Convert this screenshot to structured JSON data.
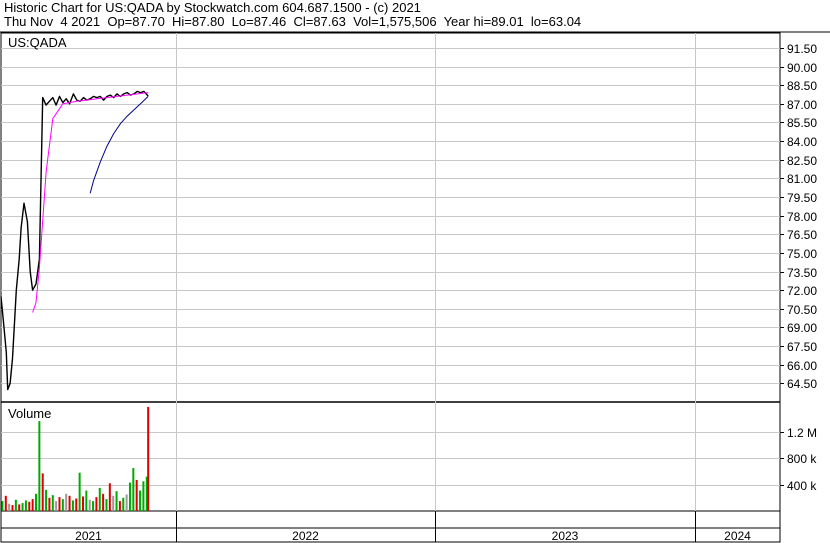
{
  "header": {
    "line1": "Historic Chart for US:QADA by Stockwatch.com 604.687.1500 - (c) 2021",
    "line2": "Thu Nov  4 2021  Op=87.70  Hi=87.80  Lo=87.46  Cl=87.63  Vol=1,575,506  Year hi=89.01  lo=63.04"
  },
  "chart_data": [
    {
      "type": "line",
      "title": "US:QADA",
      "grid": true,
      "y_ticks": [
        "91.50",
        "90.00",
        "88.50",
        "87.00",
        "85.50",
        "84.00",
        "82.50",
        "81.00",
        "79.50",
        "78.00",
        "76.50",
        "75.00",
        "73.50",
        "72.00",
        "70.50",
        "69.00",
        "67.50",
        "66.00",
        "64.50"
      ],
      "ylim": [
        63.0,
        92.7
      ],
      "x_ticks": [
        "2021",
        "2022",
        "2023",
        "2024"
      ],
      "colors": {
        "price": "#000000",
        "ma_short": "#ff00ff",
        "ma_long": "#00008b"
      },
      "series": [
        {
          "role": "price",
          "x": [
            "2021-01-01",
            "2021-01-06",
            "2021-01-12",
            "2021-01-15",
            "2021-01-20",
            "2021-01-25",
            "2021-02-02",
            "2021-02-08",
            "2021-02-12",
            "2021-02-18",
            "2021-02-25",
            "2021-03-03",
            "2021-03-08",
            "2021-03-15",
            "2021-03-22",
            "2021-03-29",
            "2021-04-05",
            "2021-04-12",
            "2021-04-19",
            "2021-04-26",
            "2021-05-03",
            "2021-05-10",
            "2021-05-17",
            "2021-05-24",
            "2021-06-01",
            "2021-06-08",
            "2021-06-15",
            "2021-06-22",
            "2021-06-29",
            "2021-07-06",
            "2021-07-13",
            "2021-07-20",
            "2021-07-27",
            "2021-08-03",
            "2021-08-10",
            "2021-08-17",
            "2021-08-24",
            "2021-08-31",
            "2021-09-07",
            "2021-09-14",
            "2021-09-21",
            "2021-09-28",
            "2021-10-05",
            "2021-10-12",
            "2021-10-19",
            "2021-10-26",
            "2021-11-04"
          ],
          "values": [
            71.5,
            69.5,
            67.0,
            64.0,
            64.5,
            66.5,
            72.0,
            74.5,
            77.0,
            79.0,
            77.5,
            73.5,
            72.0,
            72.5,
            74.5,
            87.5,
            86.9,
            87.2,
            87.5,
            86.9,
            87.6,
            87.1,
            87.4,
            87.0,
            87.8,
            87.3,
            87.2,
            87.5,
            87.3,
            87.4,
            87.6,
            87.5,
            87.6,
            87.3,
            87.6,
            87.7,
            87.5,
            87.8,
            87.6,
            87.8,
            87.9,
            87.7,
            87.8,
            88.0,
            87.9,
            88.0,
            87.63
          ]
        },
        {
          "role": "ma_short",
          "x": [
            "2021-03-08",
            "2021-03-15",
            "2021-03-22",
            "2021-04-05",
            "2021-04-19",
            "2021-05-10",
            "2021-05-24",
            "2021-06-08",
            "2021-06-29",
            "2021-07-20",
            "2021-08-10",
            "2021-08-31",
            "2021-09-21",
            "2021-10-12",
            "2021-11-04"
          ],
          "values": [
            70.2,
            71.0,
            73.8,
            81.5,
            85.8,
            87.0,
            87.1,
            87.2,
            87.3,
            87.4,
            87.5,
            87.6,
            87.7,
            87.8,
            87.9
          ]
        },
        {
          "role": "ma_long",
          "x": [
            "2021-07-06",
            "2021-07-13",
            "2021-07-27",
            "2021-08-10",
            "2021-08-24",
            "2021-09-07",
            "2021-09-21",
            "2021-10-05",
            "2021-10-19",
            "2021-11-04"
          ],
          "values": [
            79.8,
            80.8,
            82.3,
            83.6,
            84.6,
            85.4,
            86.0,
            86.5,
            87.0,
            87.6
          ]
        }
      ]
    },
    {
      "type": "bar",
      "title": "Volume",
      "y_ticks": [
        "1.2 M",
        "800 k",
        "400 k"
      ],
      "ylim": [
        0,
        1650000
      ],
      "x_ticks": [
        "2021",
        "2022",
        "2023",
        "2024"
      ],
      "colors": {
        "up": "#00aa00",
        "down": "#dd0000",
        "flat": "#999999"
      },
      "bars": {
        "x": [
          "2021-01-04",
          "2021-01-11",
          "2021-01-18",
          "2021-01-25",
          "2021-02-01",
          "2021-02-08",
          "2021-02-15",
          "2021-02-22",
          "2021-03-01",
          "2021-03-08",
          "2021-03-15",
          "2021-03-22",
          "2021-03-29",
          "2021-04-05",
          "2021-04-12",
          "2021-04-19",
          "2021-04-26",
          "2021-05-03",
          "2021-05-10",
          "2021-05-17",
          "2021-05-24",
          "2021-05-31",
          "2021-06-07",
          "2021-06-14",
          "2021-06-21",
          "2021-06-28",
          "2021-07-05",
          "2021-07-12",
          "2021-07-19",
          "2021-07-26",
          "2021-08-02",
          "2021-08-09",
          "2021-08-16",
          "2021-08-23",
          "2021-08-30",
          "2021-09-06",
          "2021-09-13",
          "2021-09-20",
          "2021-09-27",
          "2021-10-04",
          "2021-10-11",
          "2021-10-18",
          "2021-10-25",
          "2021-11-01",
          "2021-11-04"
        ],
        "values": [
          150000,
          230000,
          110000,
          90000,
          170000,
          100000,
          120000,
          160000,
          140000,
          180000,
          260000,
          1360000,
          570000,
          320000,
          200000,
          240000,
          150000,
          210000,
          180000,
          260000,
          230000,
          160000,
          190000,
          580000,
          220000,
          310000,
          170000,
          150000,
          210000,
          350000,
          260000,
          180000,
          420000,
          230000,
          300000,
          150000,
          200000,
          250000,
          430000,
          650000,
          470000,
          310000,
          450000,
          520000,
          1575506
        ],
        "direction": [
          "up",
          "down",
          "flat",
          "down",
          "up",
          "down",
          "up",
          "up",
          "down",
          "down",
          "up",
          "up",
          "down",
          "up",
          "down",
          "up",
          "flat",
          "down",
          "up",
          "flat",
          "down",
          "up",
          "down",
          "up",
          "down",
          "up",
          "flat",
          "up",
          "down",
          "up",
          "down",
          "up",
          "down",
          "flat",
          "up",
          "down",
          "up",
          "flat",
          "up",
          "up",
          "down",
          "up",
          "up",
          "up",
          "down"
        ]
      }
    }
  ]
}
